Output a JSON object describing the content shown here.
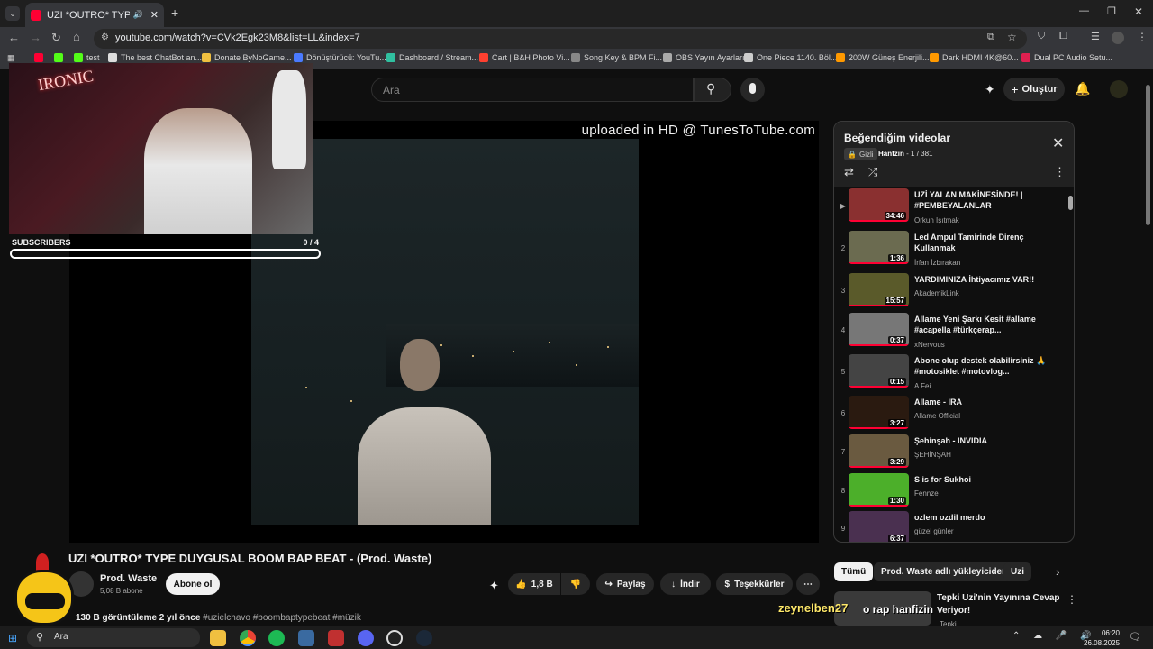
{
  "browser": {
    "tab_title": "UZI *OUTRO* TYPE DUYGUSAL",
    "url": "youtube.com/watch?v=CVk2Egk23M8&list=LL&index=7",
    "bookmarks": [
      "test",
      "The best ChatBot an...",
      "Donate ByNoGame...",
      "Dönüştürücü: YouTu...",
      "Dashboard / Stream...",
      "Cart | B&H Photo Vi...",
      "Song Key & BPM Fi...",
      "OBS Yayın Ayarları",
      "One Piece 1140. Böl...",
      "200W Güneş Enerjili...",
      "Dark HDMI 4K@60...",
      "Dual PC Audio Setu..."
    ]
  },
  "header": {
    "search_placeholder": "Ara",
    "create_label": "Oluştur"
  },
  "player": {
    "watermark": "uploaded in HD @ TunesToTube.com"
  },
  "overlay": {
    "cam_logo": "IRONIC",
    "subs_label": "SUBSCRIBERS",
    "subs_count": "0 / 4",
    "subs_progress": 0,
    "chat_user": "zeynelben27",
    "chat_message": "o rap hanfizin"
  },
  "video": {
    "title": "UZI *OUTRO* TYPE DUYGUSAL BOOM BAP BEAT - (Prod. Waste)",
    "channel": "Prod. Waste",
    "channel_subs": "5,08 B abone",
    "subscribe_label": "Abone ol",
    "likes": "1,8 B",
    "share_label": "Paylaş",
    "download_label": "İndir",
    "thanks_label": "Teşekkürler",
    "views_line": "130 B görüntüleme  2 yıl önce",
    "tags": "#uzielchavo #boombaptypebeat #müzik"
  },
  "playlist": {
    "title": "Beğendiğim videolar",
    "privacy": "Gizli",
    "owner": "Hanfzin",
    "position": "1 / 381",
    "items": [
      {
        "idx": "▶",
        "title": "UZİ YALAN MAKİNESİNDE! | #PEMBEYALANLAR",
        "channel": "Orkun Işıtmak",
        "duration": "34:46",
        "color": "#8a3030"
      },
      {
        "idx": "2",
        "title": "Led Ampul Tamirinde Direnç Kullanmak",
        "channel": "İrfan İzbırakan",
        "duration": "1:36",
        "color": "#6b6b50"
      },
      {
        "idx": "3",
        "title": "YARDIMINIZA İhtiyacımız VAR!!",
        "channel": "AkademikLink",
        "duration": "15:57",
        "color": "#5a5a2a"
      },
      {
        "idx": "4",
        "title": "Allame Yeni Şarkı Kesit #allame #acapella #türkçerap...",
        "channel": "xNervous",
        "duration": "0:37",
        "color": "#777"
      },
      {
        "idx": "5",
        "title": "Abone olup destek olabilirsiniz 🙏#motosiklet #motovlog...",
        "channel": "A Fei",
        "duration": "0:15",
        "color": "#444"
      },
      {
        "idx": "6",
        "title": "Allame - IRA",
        "channel": "Allame Official",
        "duration": "3:27",
        "color": "#2a1a10"
      },
      {
        "idx": "7",
        "title": "Şehinşah - INVIDIA",
        "channel": "ŞEHİNŞAH",
        "duration": "3:29",
        "color": "#6a5a40"
      },
      {
        "idx": "8",
        "title": "S is for Sukhoi",
        "channel": "Fennze",
        "duration": "1:30",
        "color": "#4caf2a"
      },
      {
        "idx": "9",
        "title": "ozlem ozdil merdo",
        "channel": "güzel günler",
        "duration": "6:37",
        "color": "#4a3050"
      }
    ]
  },
  "chips": [
    "Tümü",
    "Prod. Waste adlı yükleyiciden",
    "Uzi"
  ],
  "recommended": {
    "title_line1": "Tepki Uzi'nin Yayınına Cevap",
    "title_line2": "Veriyor!",
    "channel": "Tepki"
  },
  "taskbar": {
    "search": "Ara",
    "time": "06:20",
    "date": "26.08.2025"
  }
}
